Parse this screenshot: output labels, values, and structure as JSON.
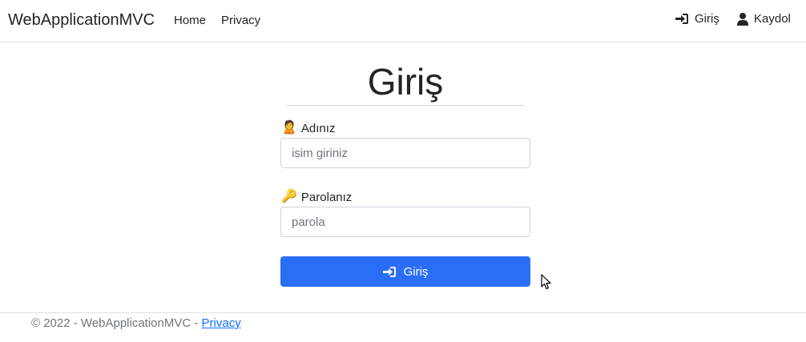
{
  "navbar": {
    "brand": "WebApplicationMVC",
    "links": [
      {
        "label": "Home"
      },
      {
        "label": "Privacy"
      }
    ],
    "login": {
      "label": "Giriş",
      "icon": "sign-in-icon"
    },
    "register": {
      "label": "Kaydol",
      "icon": "user-icon"
    }
  },
  "form": {
    "title": "Giriş",
    "name_field": {
      "label": "Adınız",
      "icon": "🙎",
      "placeholder": "isim giriniz",
      "value": ""
    },
    "password_field": {
      "label": "Parolanız",
      "icon": "🔑",
      "placeholder": "parola",
      "value": ""
    },
    "submit": {
      "label": "Giriş",
      "icon": "sign-in-icon",
      "color": "#2b6ef6"
    }
  },
  "footer": {
    "text": "© 2022 - WebApplicationMVC - ",
    "link": "Privacy"
  }
}
